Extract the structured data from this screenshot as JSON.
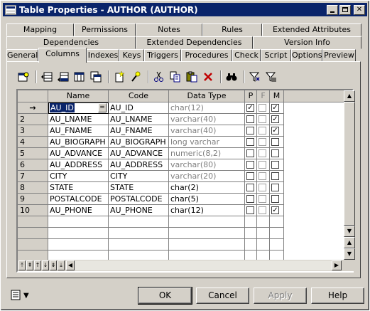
{
  "window": {
    "title": "Table Properties - AUTHOR (AUTHOR)"
  },
  "tabs": {
    "row1": [
      "Mapping",
      "Permissions",
      "Notes",
      "Rules",
      "Extended Attributes"
    ],
    "row2": [
      "Dependencies",
      "Extended Dependencies",
      "Version Info"
    ],
    "row3": [
      "General",
      "Columns",
      "Indexes",
      "Keys",
      "Triggers",
      "Procedures",
      "Check",
      "Script",
      "Options",
      "Preview"
    ],
    "active": "Columns"
  },
  "toolbar": {
    "icons": [
      "properties-icon",
      "insert-row-icon",
      "add-row-icon",
      "add-columns-icon",
      "replicate-icon",
      "new-icon",
      "wizard-icon",
      "cut-icon",
      "copy-icon",
      "paste-icon",
      "delete-icon",
      "find-icon",
      "filter-icon",
      "clear-filter-icon"
    ]
  },
  "grid": {
    "headers": [
      "Name",
      "Code",
      "Data Type",
      "P",
      "F",
      "M"
    ],
    "rows": [
      {
        "num": "→",
        "name": "AU_ID",
        "code": "AU_ID",
        "type": "char(12)",
        "type_gray": true,
        "p": true,
        "f": false,
        "m": true
      },
      {
        "num": "2",
        "name": "AU_LNAME",
        "code": "AU_LNAME",
        "type": "varchar(40)",
        "type_gray": true,
        "p": false,
        "f": false,
        "m": true
      },
      {
        "num": "3",
        "name": "AU_FNAME",
        "code": "AU_FNAME",
        "type": "varchar(40)",
        "type_gray": true,
        "p": false,
        "f": false,
        "m": true
      },
      {
        "num": "4",
        "name": "AU_BIOGRAPH",
        "code": "AU_BIOGRAPH",
        "type": "long varchar",
        "type_gray": true,
        "p": false,
        "f": false,
        "m": false
      },
      {
        "num": "5",
        "name": "AU_ADVANCE",
        "code": "AU_ADVANCE",
        "type": "numeric(8,2)",
        "type_gray": true,
        "p": false,
        "f": false,
        "m": false
      },
      {
        "num": "6",
        "name": "AU_ADDRESS",
        "code": "AU_ADDRESS",
        "type": "varchar(80)",
        "type_gray": true,
        "p": false,
        "f": false,
        "m": false
      },
      {
        "num": "7",
        "name": "CITY",
        "code": "CITY",
        "type": "varchar(20)",
        "type_gray": true,
        "p": false,
        "f": false,
        "m": false
      },
      {
        "num": "8",
        "name": "STATE",
        "code": "STATE",
        "type": "char(2)",
        "type_gray": false,
        "p": false,
        "f": false,
        "m": false
      },
      {
        "num": "9",
        "name": "POSTALCODE",
        "code": "POSTALCODE",
        "type": "char(5)",
        "type_gray": false,
        "p": false,
        "f": false,
        "m": false
      },
      {
        "num": "10",
        "name": "AU_PHONE",
        "code": "AU_PHONE",
        "type": "char(12)",
        "type_gray": false,
        "p": false,
        "f": false,
        "m": true
      }
    ],
    "empty_rows": 5,
    "cell_button": "="
  },
  "buttons": {
    "ok": "OK",
    "cancel": "Cancel",
    "apply": "Apply",
    "help": "Help"
  },
  "colors": {
    "titlebar": "#0a246a",
    "face": "#d4d0c8",
    "selection": "#0a246a"
  }
}
